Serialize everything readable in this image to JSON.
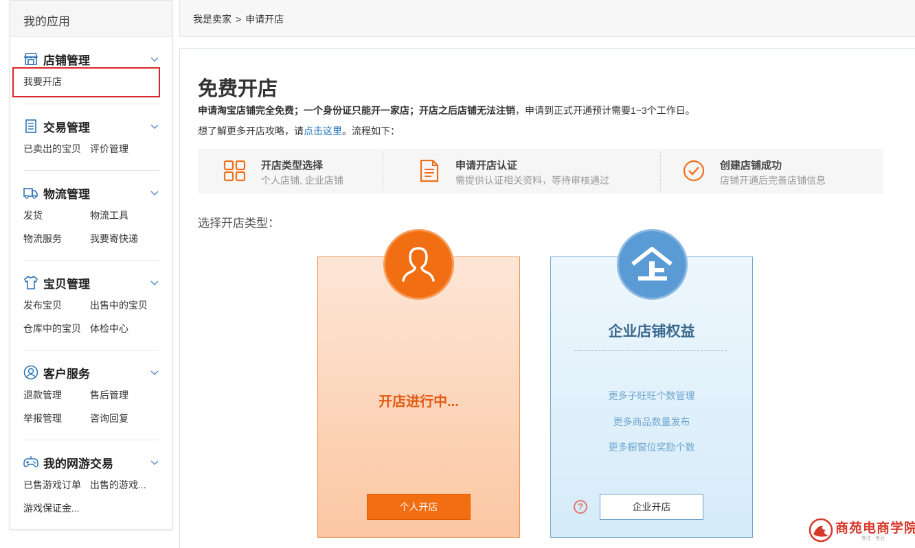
{
  "sidebar": {
    "title": "我的应用",
    "groups": [
      {
        "title": "店铺管理",
        "icon": "store-icon",
        "links": [
          "我要开店"
        ]
      },
      {
        "title": "交易管理",
        "icon": "receipt-icon",
        "links": [
          "已卖出的宝贝",
          "评价管理"
        ]
      },
      {
        "title": "物流管理",
        "icon": "truck-icon",
        "links": [
          "发货",
          "物流工具",
          "物流服务",
          "我要寄快递"
        ]
      },
      {
        "title": "宝贝管理",
        "icon": "shirt-icon",
        "links": [
          "发布宝贝",
          "出售中的宝贝",
          "仓库中的宝贝",
          "体检中心"
        ]
      },
      {
        "title": "客户服务",
        "icon": "user-circle-icon",
        "links": [
          "退款管理",
          "售后管理",
          "举报管理",
          "咨询回复"
        ]
      },
      {
        "title": "我的网游交易",
        "icon": "gamepad-icon",
        "links": [
          "已售游戏订单",
          "出售的游戏...",
          "游戏保证金..."
        ]
      }
    ]
  },
  "breadcrumb": {
    "parent": "我是卖家",
    "separator": ">",
    "current": "申请开店"
  },
  "main": {
    "heading": "免费开店",
    "desc_bold": "申请淘宝店铺完全免费；一个身份证只能开一家店；开店之后店铺无法注销",
    "desc_rest": "，申请到正式开通预计需要1~3个工作日。",
    "guide_prefix": "想了解更多开店攻略，请",
    "guide_link": "点击这里",
    "guide_suffix": "。流程如下：",
    "steps": [
      {
        "title": "开店类型选择",
        "subtitle": "个人店铺, 企业店铺",
        "icon": "grid-icon"
      },
      {
        "title": "申请开店认证",
        "subtitle": "需提供认证相关资料，等待审核通过",
        "icon": "document-icon"
      },
      {
        "title": "创建店铺成功",
        "subtitle": "店铺开通后完善店铺信息",
        "icon": "check-circle-icon"
      }
    ],
    "choose_label": "选择开店类型：",
    "personal": {
      "status": "开店进行中...",
      "button": "个人开店"
    },
    "company": {
      "title": "企业店铺权益",
      "benefits": [
        "更多子旺旺个数管理",
        "更多商品数量发布",
        "更多橱窗位奖励个数"
      ],
      "button": "企业开店",
      "help": "?"
    }
  },
  "watermark": {
    "name": "商苑电商学院",
    "tagline": "专注 · 专业"
  },
  "colors": {
    "accent_orange": "#f26e12",
    "accent_blue": "#5b9bd5",
    "link_blue": "#1b72c2",
    "highlight_red": "#d9262c"
  }
}
